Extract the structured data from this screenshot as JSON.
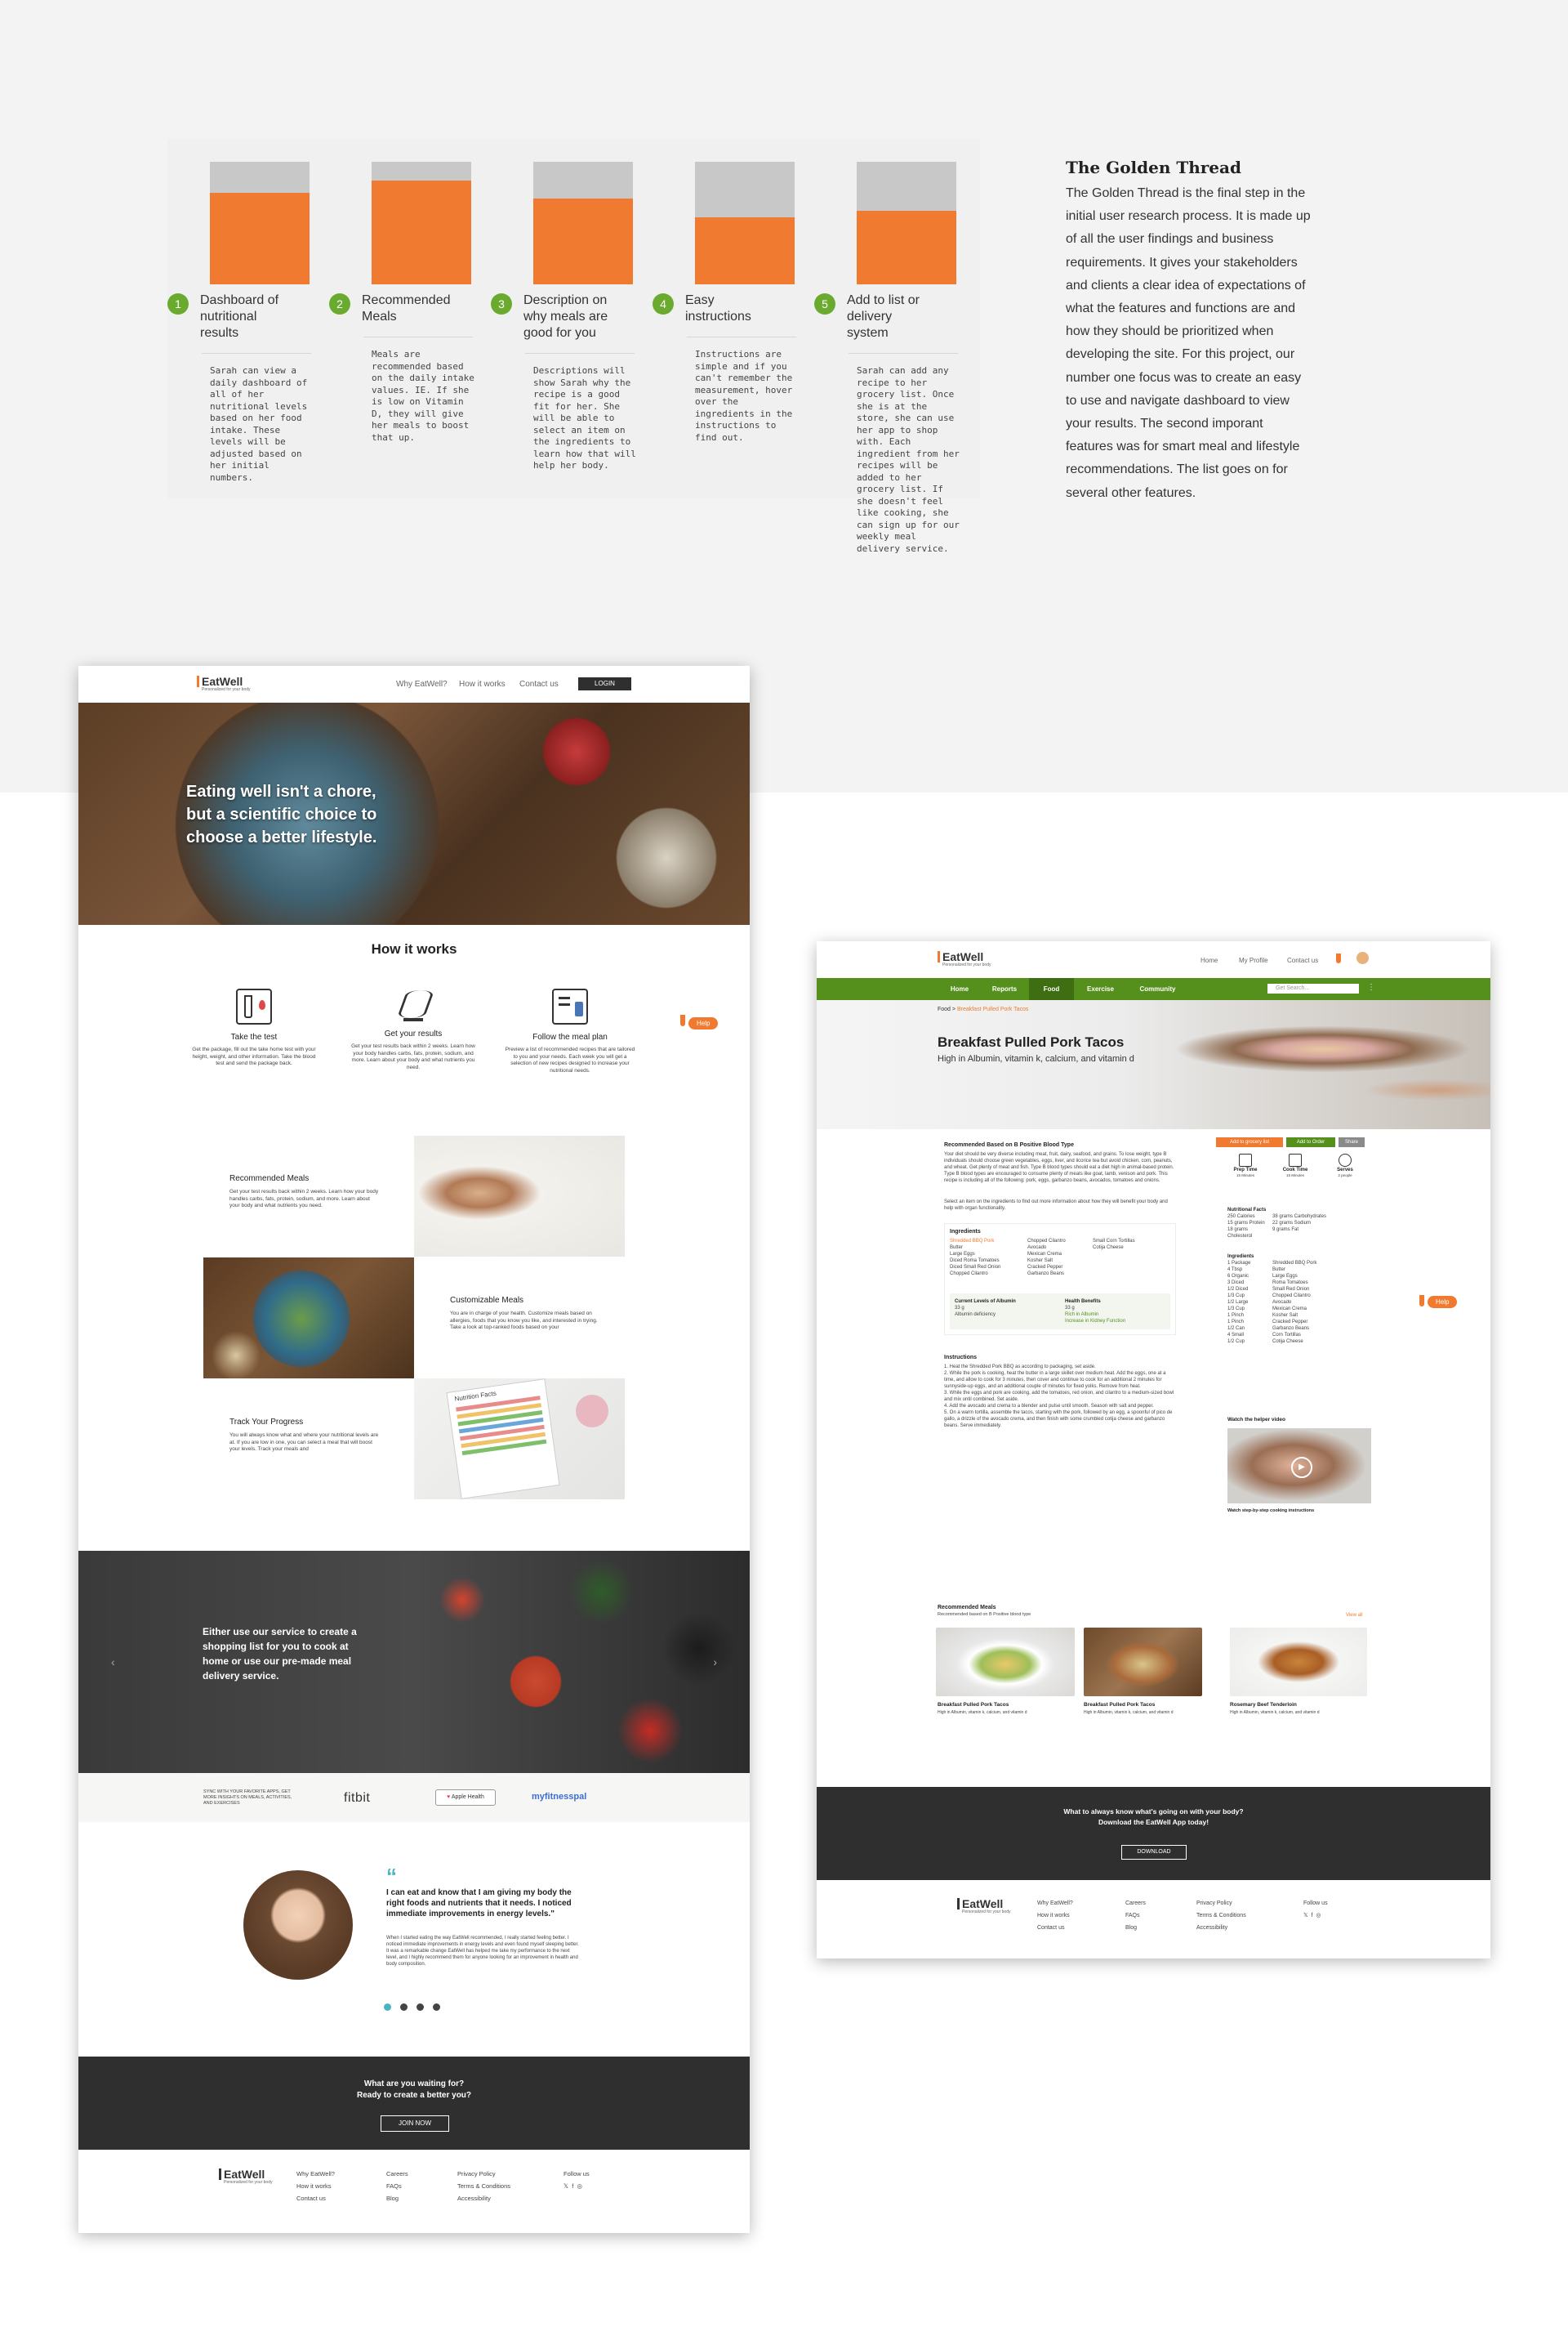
{
  "golden_thread": {
    "steps": [
      {
        "num": "1",
        "title": "Dashboard of nutritional results",
        "fill": 0.75,
        "desc": "Sarah can view a daily dashboard of all of her nutritional levels based on her food intake. These levels will be adjusted based on her initial numbers."
      },
      {
        "num": "2",
        "title": "Recommended Meals",
        "fill": 0.85,
        "desc": "Meals are recommended based on the daily intake values. IE. If she is low on Vitamin D, they will give her meals to boost that up."
      },
      {
        "num": "3",
        "title": "Description on why meals are good for you",
        "fill": 0.7,
        "desc": "Descriptions will show Sarah why the recipe is a good fit for her. She will be able to select an item on the ingredients to learn how that will help her body."
      },
      {
        "num": "4",
        "title": "Easy instructions",
        "fill": 0.55,
        "desc": "Instructions are simple and if you can't remember the measurement, hover over the ingredients in the instructions to find out."
      },
      {
        "num": "5",
        "title": "Add to list or delivery system",
        "fill": 0.6,
        "desc": "Sarah can add any recipe to her grocery list. Once she is at the store, she can use her app to shop with. Each ingredient from her recipes will be added to her grocery list. If she doesn't feel like cooking, she can sign up for our weekly meal delivery service."
      }
    ],
    "side_title": "The Golden Thread",
    "side_text": "The Golden Thread is the final step in the initial user research process. It is made up of all the user findings and business requirements. It gives your stakeholders and clients a clear idea of expectations of what the features and functions are and how they should be prioritized when developing the site. For this project, our number one focus was to create an easy to use and navigate dashboard to view your results. The second imporant features was for smart meal and lifestyle recommendations. The list goes on for several other features."
  },
  "landing": {
    "logo": "EatWell",
    "logo_sub": "Personalized for your body",
    "nav": [
      "Why EatWell?",
      "How it works",
      "Contact us"
    ],
    "login": "LOGIN",
    "hero_text": "Eating well isn't a chore, but a scientific choice to choose a better lifestyle.",
    "how_title": "How it works",
    "features": [
      {
        "title": "Take the test",
        "desc": "Get the package, fill out the take home test with your height, weight, and other information. Take the blood test and send the package back."
      },
      {
        "title": "Get your results",
        "desc": "Get your test results back within 2 weeks. Learn how your body handles carbs, fats, protein, sodium, and more. Learn about your body and what nutrients you need."
      },
      {
        "title": "Follow the meal plan",
        "desc": "Preview a list of recommended recipes that are tailored to you and your needs. Each week you will get a selection of new recipes designed to increase your nutritional needs."
      }
    ],
    "help": "Help",
    "blocks": [
      {
        "title": "Recommended Meals",
        "desc": "Get your test results back within 2 weeks. Learn how your body handles carbs, fats, protein, sodium, and more. Learn about your body and what nutrients you need."
      },
      {
        "title": "Customizable Meals",
        "desc": "You are in charge of your health. Customize meals based on allergies, foods that you know you like, and interested in trying. Take a look at top-ranked foods based on your"
      },
      {
        "title": "Track Your Progress",
        "desc": "You will always know what and where your nutritional levels are at. If you are low in one, you can select a meal that will boost your levels. Track your meals and"
      }
    ],
    "nutrition_label": "Nutrition Facts",
    "veg_text": "Either use our service to create a shopping list for you to cook at home or use our pre-made meal delivery service.",
    "sync_text": "SYNC WITH YOUR FAVORITE APPS, GET MORE INSIGHTS ON MEALS, ACTIVITIES, AND EXERCISES",
    "partners": [
      "fitbit",
      "Apple Health",
      "myfitnesspal"
    ],
    "quote_mark": "“",
    "quote": "I can eat and know that I am giving my body the right foods and nutrients that it needs. I noticed immediate improvements in energy levels.\"",
    "quote_body": "When I started eating the way EatWell recommended, I really started feeling better. I noticed immediate improvements in energy levels and even found myself sleeping better. It was a remarkable change EatWell has helped me take my performance to the next level, and I highly recommend them for anyone looking for an improvement in health and body composition.",
    "cta_line1": "What are you waiting for?",
    "cta_line2": "Ready to create a better you?",
    "cta_button": "JOIN NOW",
    "footer": [
      [
        "Why EatWell?",
        "How it works",
        "Contact us"
      ],
      [
        "Careers",
        "FAQs",
        "Blog"
      ],
      [
        "Privacy Policy",
        "Terms & Conditions",
        "Accessibility"
      ]
    ],
    "follow": "Follow us",
    "social": [
      "𝕏",
      "f",
      "◎"
    ]
  },
  "recipe": {
    "logo": "EatWell",
    "logo_sub": "Personalized for your body",
    "nav": [
      "Home",
      "My Profile",
      "Contact us"
    ],
    "tabs": [
      "Home",
      "Reports",
      "Food",
      "Exercise",
      "Community"
    ],
    "search_placeholder": "Get Search...",
    "breadcrumb_root": "Food",
    "breadcrumb_sep": " > ",
    "breadcrumb_leaf": "Breakfast Pulled Pork Tacos",
    "title": "Breakfast Pulled Pork Tacos",
    "subtitle": "High in Albumin, vitamin k, calcium, and vitamin d",
    "based_title": "Recommended Based on B Positive Blood Type",
    "based_text": "Your diet should be very diverse including meat, fruit, dairy, seafood, and grains. To lose weight, type B individuals should choose green vegetables, eggs, liver, and licorice tea but avoid chicken, corn, peanuts, and wheat. Get plenty of meat and fish. Type B blood types should eat a diet high in animal-based protein. Type B blood types are encouraged to consume plenty of meats like goat, lamb, venison and pork. This recipe is including all of the following: pork, eggs, garbanzo beans, avocados, tomatoes and onions.",
    "select_text": "Select an item on the ingredients to find out more information about how they will benefit your body and help with organ functionality.",
    "ingredients_title": "Ingredients",
    "ingredients_cols": [
      [
        "Shredded BBQ Pork",
        "Butter",
        "Large Eggs",
        "Diced Roma Tomatoes",
        "Diced Small Red Onion",
        "Chopped Cilantro"
      ],
      [
        "Chopped Cilantro",
        "Avocado",
        "Mexican Crema",
        "Kosher Salt",
        "Cracked Pepper",
        "Garbanzo Beans"
      ],
      [
        "Small Corn Tortillas",
        "Cotija Cheese"
      ]
    ],
    "levels_title": "Current Levels of Albumin",
    "levels_vals": [
      "33 g",
      "Albumin deficiency"
    ],
    "benefits_title": "Health Benefits",
    "benefits_vals": [
      "33 g",
      "Rich in Albumin",
      "Increase in Kidney Function"
    ],
    "instructions_title": "Instructions",
    "instructions": [
      "1. Heat the Shredded Pork BBQ as according to packaging, set aside.",
      "2. While the pork is cooking, heat the butter in a large skillet over medium heat. Add the eggs, one at a time, and allow to cook for 3 minutes, then cover and continue to cook for an additional 2 minutes for sunnyside-up eggs, and an additional couple of minutes for fixed yolks. Remove from heat.",
      "3. While the eggs and pork are cooking, add the tomatoes, red onion, and cilantro to a medium-sized bowl and mix until combined. Set aside.",
      "4. Add the avocado and crema to a blender and pulse until smooth. Season with salt and pepper.",
      "5. On a warm tortilla, assemble the tacos, starting with the pork, followed by an egg, a spoonful of pico de gallo, a drizzle of the avocado crema, and then finish with some crumbled cotija cheese and garbanzo beans. Serve immediately."
    ],
    "buttons": [
      "Add to grocery list",
      "Add to Order",
      "Share"
    ],
    "meta": [
      {
        "label": "Prep Time",
        "val": "15 Minutes"
      },
      {
        "label": "Cook Time",
        "val": "15 Minutes"
      },
      {
        "label": "Serves",
        "val": "2 people"
      }
    ],
    "nutrition_title": "Nutritional Facts",
    "nutrition": [
      [
        "250 Calories",
        "38 grams Carbohydrates"
      ],
      [
        "15 grams Protein",
        "22 grams Sodium"
      ],
      [
        "18 grams Cholesterol",
        "9 grams Fat"
      ]
    ],
    "side_ing_title": "Ingredients",
    "side_ing": [
      [
        "1 Package",
        "Shredded BBQ Pork"
      ],
      [
        "4 Tbsp",
        "Butter"
      ],
      [
        "6 Organic",
        "Large Eggs"
      ],
      [
        "3 Diced",
        "Roma Tomatoes"
      ],
      [
        "1/2 Diced",
        "Small Red Onion"
      ],
      [
        "1/3 Cup",
        "Chopped Cilantro"
      ],
      [
        "1/2 Large",
        "Avocado"
      ],
      [
        "1/3 Cup",
        "Mexican Crema"
      ],
      [
        "1 Pinch",
        "Kosher Salt"
      ],
      [
        "1 Pinch",
        "Cracked Pepper"
      ],
      [
        "1/2 Can",
        "Garbanzo Beans"
      ],
      [
        "4 Small",
        "Corn Tortillas"
      ],
      [
        "1/2 Cup",
        "Cotija Cheese"
      ]
    ],
    "video_title": "Watch the helper video",
    "video_caption": "Watch step-by-step cooking instructions",
    "rec_title": "Recommended Meals",
    "rec_sub": "Recommended based on B Positive blood type",
    "view_all": "View all",
    "meals": [
      {
        "name": "Breakfast Pulled Pork Tacos",
        "desc": "High in Albumin, vitamin k, calcium, and vitamin d"
      },
      {
        "name": "Breakfast Pulled Pork Tacos",
        "desc": "High in Albumin, vitamin k, calcium, and vitamin d"
      },
      {
        "name": "Rosemary Beef Tenderloin",
        "desc": "High in Albumin, vitamin k, calcium, and vitamin d"
      }
    ],
    "help": "Help",
    "app_line1": "What to always know what's going on with your body?",
    "app_line2": "Download the EatWell App today!",
    "app_button": "DOWNLOAD",
    "footer": [
      [
        "Why EatWell?",
        "How it works",
        "Contact us"
      ],
      [
        "Careers",
        "FAQs",
        "Blog"
      ],
      [
        "Privacy Policy",
        "Terms & Conditions",
        "Accessibility"
      ]
    ],
    "follow": "Follow us",
    "social": [
      "𝕏",
      "f",
      "◎"
    ]
  },
  "colors": {
    "orange": "#f07a2f",
    "green": "#55901c",
    "step_green": "#6aab2f",
    "dark": "#2f2f2f"
  }
}
